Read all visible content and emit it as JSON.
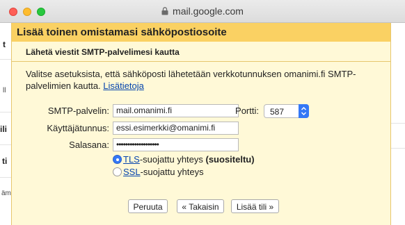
{
  "browser": {
    "url": "mail.google.com"
  },
  "background": {
    "frag1": "t",
    "frag2": "ll",
    "frag3": "ili",
    "frag4": "ti",
    "frag5": "ämi"
  },
  "dialog": {
    "title": "Lisää toinen omistamasi sähköpostiosoite",
    "subtitle": "Lähetä viestit SMTP-palvelimesi kautta",
    "description": "Valitse asetuksista, että sähköposti lähetetään verkkotunnuksen omanimi.fi SMTP-palvelimien kautta.",
    "learn_more": "Lisätietoja",
    "smtp_label": "SMTP-palvelin:",
    "smtp_value": "mail.omanimi.fi",
    "port_label": "Portti:",
    "port_value": "587",
    "username_label": "Käyttäjätunnus:",
    "username_value": "essi.esimerkki@omanimi.fi",
    "password_label": "Salasana:",
    "password_value": "•••••••••••••••••••",
    "tls_link": "TLS",
    "tls_rest": "-suojattu yhteys ",
    "tls_recommended": "(suositeltu)",
    "ssl_link": "SSL",
    "ssl_rest": "-suojattu yhteys",
    "cancel_label": "Peruuta",
    "back_label": "« Takaisin",
    "add_label": "Lisää tili »"
  }
}
